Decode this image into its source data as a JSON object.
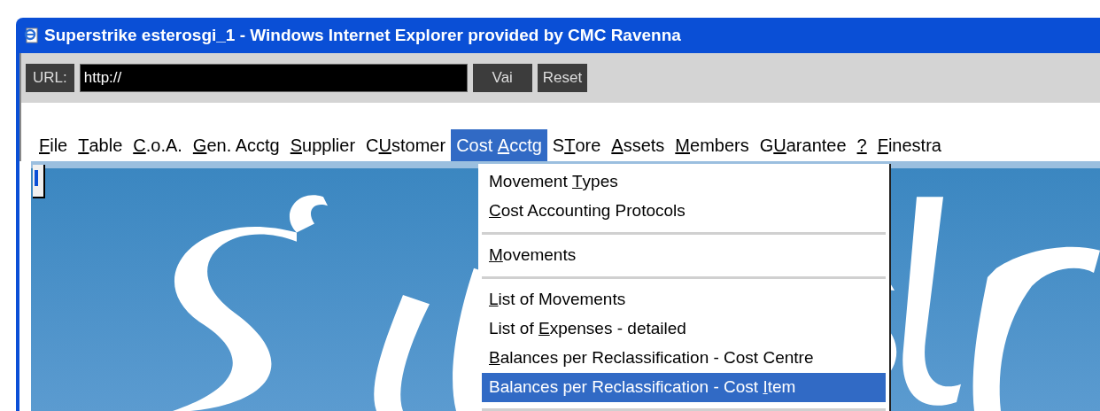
{
  "window": {
    "title": "Superstrike esterosgi_1 - Windows Internet Explorer provided by CMC Ravenna"
  },
  "address_bar": {
    "label": "URL:",
    "value": "http://",
    "buttons": [
      "Vai",
      "Reset"
    ]
  },
  "menu_bar": [
    {
      "key": "F",
      "post": "ile",
      "selected": false
    },
    {
      "key": "T",
      "post": "able",
      "selected": false
    },
    {
      "key": "C",
      "post": ".o.A.",
      "selected": false
    },
    {
      "key": "G",
      "post": "en. Acctg",
      "selected": false
    },
    {
      "key": "S",
      "post": "upplier",
      "selected": false
    },
    {
      "pre": "C",
      "key": "U",
      "post": "stomer",
      "selected": false
    },
    {
      "pre": "Cost ",
      "key": "A",
      "post": "cctg",
      "selected": true
    },
    {
      "pre": "S",
      "key": "T",
      "post": "ore",
      "selected": false
    },
    {
      "key": "A",
      "post": "ssets",
      "selected": false
    },
    {
      "key": "M",
      "post": "embers",
      "selected": false
    },
    {
      "pre": "G",
      "key": "U",
      "post": "arantee",
      "selected": false
    },
    {
      "key": "?",
      "selected": false
    },
    {
      "key": "F",
      "post": "inestra",
      "selected": false
    }
  ],
  "dropdown": [
    {
      "kind": "item",
      "pre": "Movement ",
      "key": "T",
      "post": "ypes",
      "selected": false
    },
    {
      "kind": "item",
      "key": "C",
      "post": "ost Accounting Protocols",
      "selected": false
    },
    {
      "kind": "separator"
    },
    {
      "kind": "item",
      "key": "M",
      "post": "ovements",
      "selected": false
    },
    {
      "kind": "separator"
    },
    {
      "kind": "item",
      "key": "L",
      "post": "ist of Movements",
      "selected": false
    },
    {
      "kind": "item",
      "pre": "List of ",
      "key": "E",
      "post": "xpenses - detailed",
      "selected": false
    },
    {
      "kind": "item",
      "key": "B",
      "post": "alances per Reclassification - Cost Centre",
      "selected": false
    },
    {
      "kind": "item",
      "pre": "Balances per Reclassification - Cost ",
      "key": "I",
      "post": "tem",
      "selected": true
    },
    {
      "kind": "separator"
    }
  ]
}
